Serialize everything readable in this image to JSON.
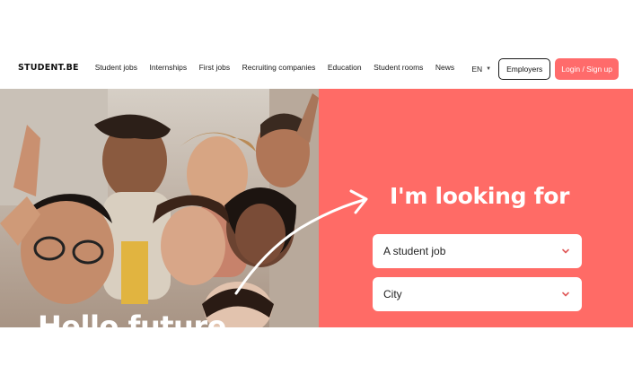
{
  "brand": {
    "logo_text": "STUDENT.BE"
  },
  "nav": {
    "links": [
      "Student jobs",
      "Internships",
      "First jobs",
      "Recruiting companies",
      "Education",
      "Student rooms",
      "News"
    ],
    "language": "EN",
    "employers_label": "Employers",
    "login_label": "Login / Sign up"
  },
  "hero": {
    "headline": "I'm looking for",
    "job_select_value": "A student job",
    "city_select_value": "City",
    "photo_caption": "Hello future"
  },
  "colors": {
    "accent": "#ff6b66",
    "button_accent": "#ff6b6b",
    "text_dark": "#1a1a1a",
    "chevron": "#e05a5a"
  },
  "icons": {
    "lang_caret": "caret-down-icon",
    "select_chevron": "chevron-down-icon",
    "hero_arrow": "curved-arrow-icon"
  }
}
